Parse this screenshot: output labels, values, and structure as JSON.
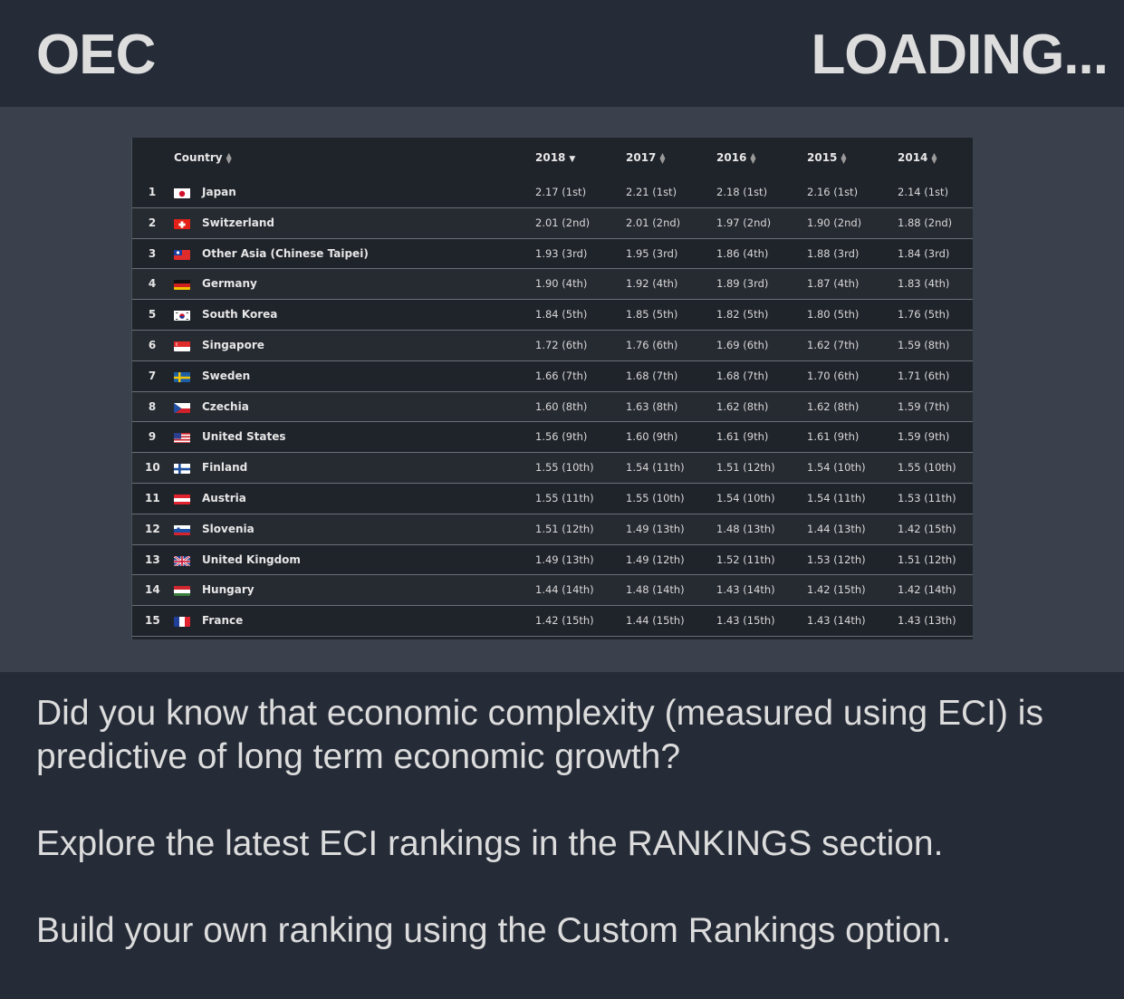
{
  "header": {
    "brand": "OEC",
    "status": "LOADING..."
  },
  "table": {
    "columns": {
      "country": "Country",
      "y2018": "2018",
      "y2017": "2017",
      "y2016": "2016",
      "y2015": "2015",
      "y2014": "2014"
    },
    "rows": [
      {
        "rank": "1",
        "country": "Japan",
        "flag": "japan",
        "v2018": "2.17 (1st)",
        "v2017": "2.21 (1st)",
        "v2016": "2.18 (1st)",
        "v2015": "2.16 (1st)",
        "v2014": "2.14 (1st)"
      },
      {
        "rank": "2",
        "country": "Switzerland",
        "flag": "switzerland",
        "v2018": "2.01 (2nd)",
        "v2017": "2.01 (2nd)",
        "v2016": "1.97 (2nd)",
        "v2015": "1.90 (2nd)",
        "v2014": "1.88 (2nd)"
      },
      {
        "rank": "3",
        "country": "Other Asia (Chinese Taipei)",
        "flag": "taiwan",
        "v2018": "1.93 (3rd)",
        "v2017": "1.95 (3rd)",
        "v2016": "1.86 (4th)",
        "v2015": "1.88 (3rd)",
        "v2014": "1.84 (3rd)"
      },
      {
        "rank": "4",
        "country": "Germany",
        "flag": "germany",
        "v2018": "1.90 (4th)",
        "v2017": "1.92 (4th)",
        "v2016": "1.89 (3rd)",
        "v2015": "1.87 (4th)",
        "v2014": "1.83 (4th)"
      },
      {
        "rank": "5",
        "country": "South Korea",
        "flag": "south-korea",
        "v2018": "1.84 (5th)",
        "v2017": "1.85 (5th)",
        "v2016": "1.82 (5th)",
        "v2015": "1.80 (5th)",
        "v2014": "1.76 (5th)"
      },
      {
        "rank": "6",
        "country": "Singapore",
        "flag": "singapore",
        "v2018": "1.72 (6th)",
        "v2017": "1.76 (6th)",
        "v2016": "1.69 (6th)",
        "v2015": "1.62 (7th)",
        "v2014": "1.59 (8th)"
      },
      {
        "rank": "7",
        "country": "Sweden",
        "flag": "sweden",
        "v2018": "1.66 (7th)",
        "v2017": "1.68 (7th)",
        "v2016": "1.68 (7th)",
        "v2015": "1.70 (6th)",
        "v2014": "1.71 (6th)"
      },
      {
        "rank": "8",
        "country": "Czechia",
        "flag": "czechia",
        "v2018": "1.60 (8th)",
        "v2017": "1.63 (8th)",
        "v2016": "1.62 (8th)",
        "v2015": "1.62 (8th)",
        "v2014": "1.59 (7th)"
      },
      {
        "rank": "9",
        "country": "United States",
        "flag": "united-states",
        "v2018": "1.56 (9th)",
        "v2017": "1.60 (9th)",
        "v2016": "1.61 (9th)",
        "v2015": "1.61 (9th)",
        "v2014": "1.59 (9th)"
      },
      {
        "rank": "10",
        "country": "Finland",
        "flag": "finland",
        "v2018": "1.55 (10th)",
        "v2017": "1.54 (11th)",
        "v2016": "1.51 (12th)",
        "v2015": "1.54 (10th)",
        "v2014": "1.55 (10th)"
      },
      {
        "rank": "11",
        "country": "Austria",
        "flag": "austria",
        "v2018": "1.55 (11th)",
        "v2017": "1.55 (10th)",
        "v2016": "1.54 (10th)",
        "v2015": "1.54 (11th)",
        "v2014": "1.53 (11th)"
      },
      {
        "rank": "12",
        "country": "Slovenia",
        "flag": "slovenia",
        "v2018": "1.51 (12th)",
        "v2017": "1.49 (13th)",
        "v2016": "1.48 (13th)",
        "v2015": "1.44 (13th)",
        "v2014": "1.42 (15th)"
      },
      {
        "rank": "13",
        "country": "United Kingdom",
        "flag": "united-kingdom",
        "v2018": "1.49 (13th)",
        "v2017": "1.49 (12th)",
        "v2016": "1.52 (11th)",
        "v2015": "1.53 (12th)",
        "v2014": "1.51 (12th)"
      },
      {
        "rank": "14",
        "country": "Hungary",
        "flag": "hungary",
        "v2018": "1.44 (14th)",
        "v2017": "1.48 (14th)",
        "v2016": "1.43 (14th)",
        "v2015": "1.42 (15th)",
        "v2014": "1.42 (14th)"
      },
      {
        "rank": "15",
        "country": "France",
        "flag": "france",
        "v2018": "1.42 (15th)",
        "v2017": "1.44 (15th)",
        "v2016": "1.43 (15th)",
        "v2015": "1.43 (14th)",
        "v2014": "1.43 (13th)"
      }
    ]
  },
  "info": {
    "p1": "Did you know that economic complexity (measured using ECI) is predictive of long term economic growth?",
    "p2": "Explore the latest ECI rankings in the RANKINGS section.",
    "p3": "Build your own ranking using the Custom Rankings option."
  }
}
